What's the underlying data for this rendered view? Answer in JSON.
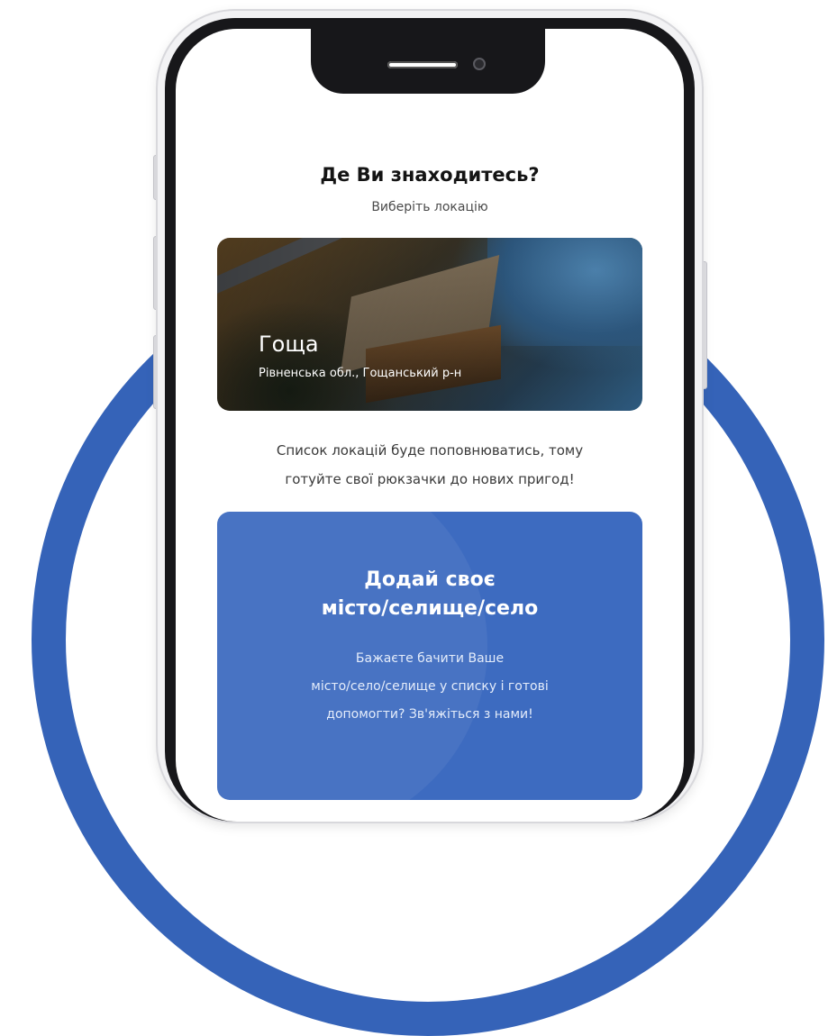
{
  "header": {
    "title": "Де Ви знаходитесь?",
    "subtitle": "Виберіть локацію"
  },
  "location_card": {
    "name": "Гоща",
    "region": "Рівненська обл., Гощанський р-н"
  },
  "note": {
    "line1": "Список локацій буде поповнюватись, тому",
    "line2": "готуйте свої рюкзачки до нових пригод!"
  },
  "cta": {
    "title_line1": "Додай своє",
    "title_line2": "місто/селище/село",
    "text_line1": "Бажаєте бачити Ваше",
    "text_line2": "місто/село/селище у списку і готові",
    "text_line3": "допомогти? Зв'яжіться з нами!"
  },
  "colors": {
    "accent_blue": "#3d6bc0",
    "arc_blue": "#3563b8"
  }
}
